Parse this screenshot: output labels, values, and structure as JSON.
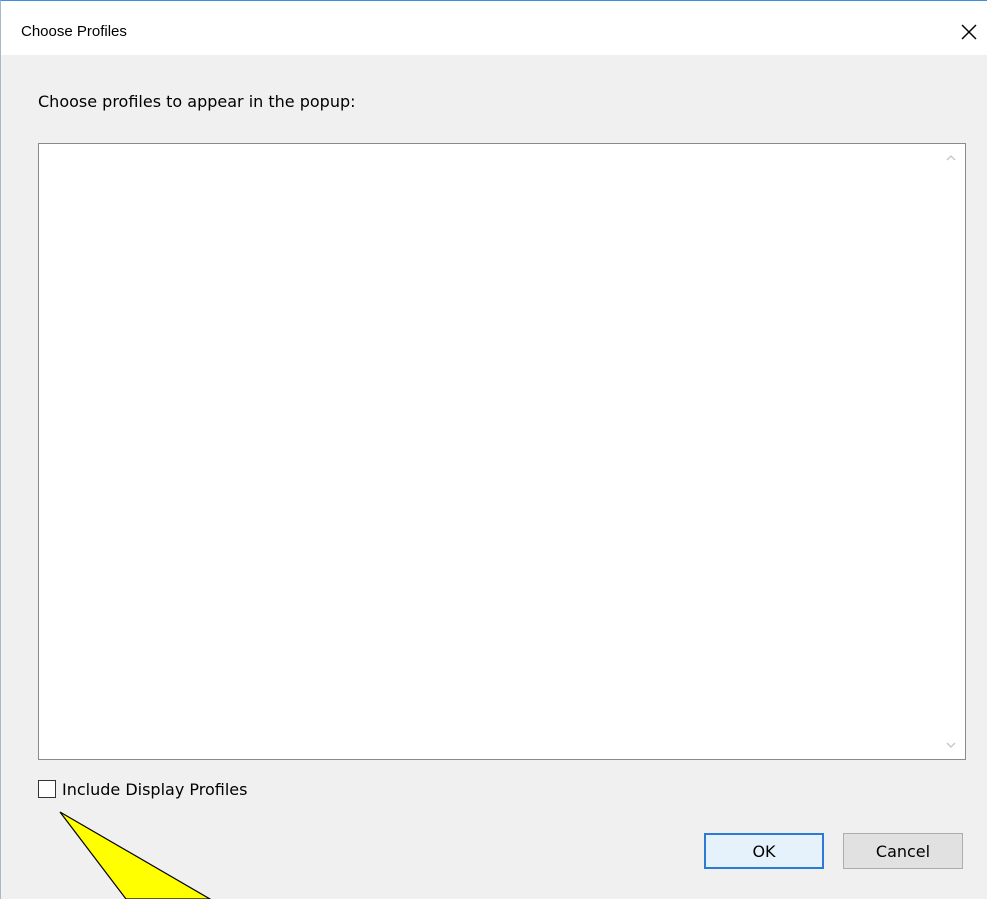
{
  "window": {
    "title": "Choose Profiles",
    "close_icon": "close-icon"
  },
  "main": {
    "prompt": "Choose profiles to appear in the popup:",
    "profile_list": {
      "items": [],
      "scroll_up_icon": "chevron-up-icon",
      "scroll_down_icon": "chevron-down-icon"
    },
    "include_display_profiles": {
      "label": "Include Display Profiles",
      "checked": false
    }
  },
  "buttons": {
    "ok_label": "OK",
    "cancel_label": "Cancel"
  },
  "annotation": {
    "fill_color": "#ffff00",
    "stroke_color": "#000000"
  },
  "colors": {
    "default_button_border": "#2a7ad6",
    "window_border": "#3c8fd8"
  }
}
